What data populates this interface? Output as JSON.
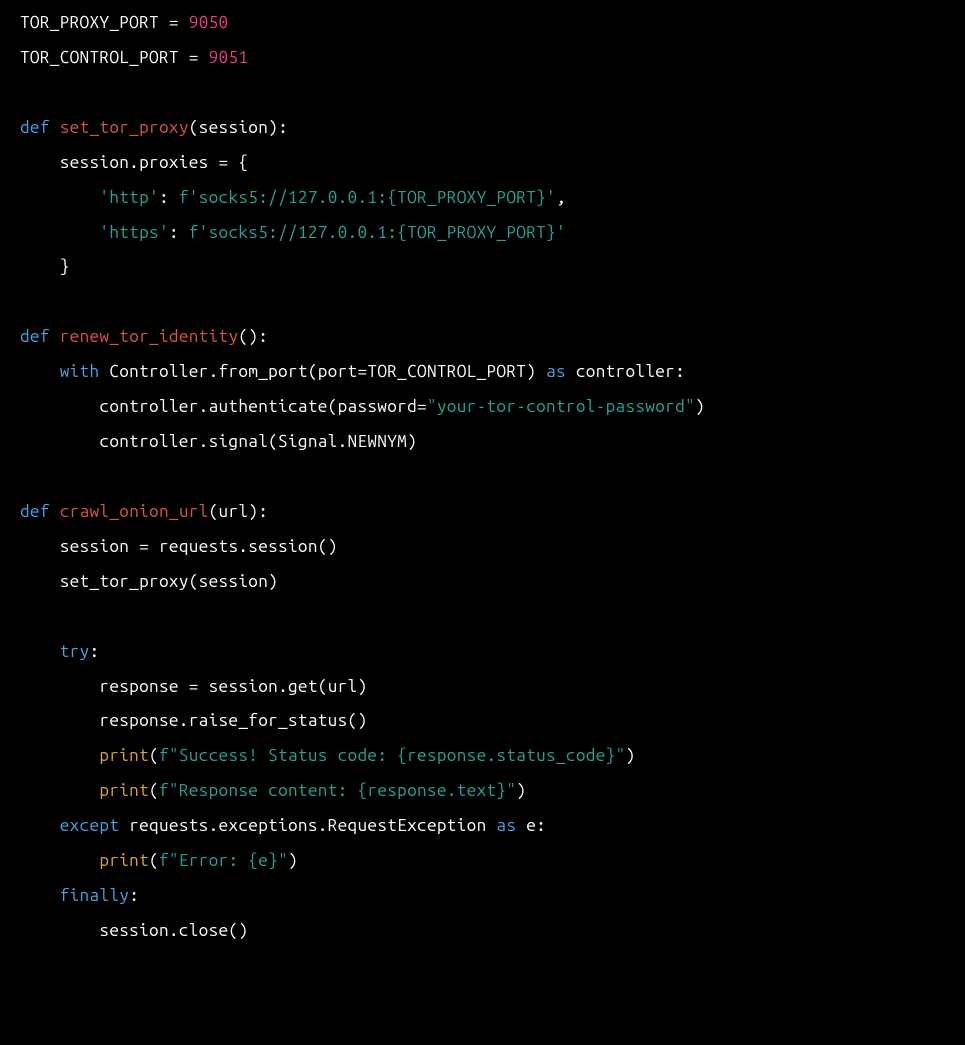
{
  "code_tokens": [
    [
      {
        "cls": "tok-const",
        "t": "TOR_PROXY_PORT"
      },
      {
        "cls": "tok-default",
        "t": " "
      },
      {
        "cls": "tok-op",
        "t": "="
      },
      {
        "cls": "tok-default",
        "t": " "
      },
      {
        "cls": "tok-number",
        "t": "9050"
      }
    ],
    [
      {
        "cls": "tok-const",
        "t": "TOR_CONTROL_PORT"
      },
      {
        "cls": "tok-default",
        "t": " "
      },
      {
        "cls": "tok-op",
        "t": "="
      },
      {
        "cls": "tok-default",
        "t": " "
      },
      {
        "cls": "tok-number",
        "t": "9051"
      }
    ],
    [],
    [
      {
        "cls": "tok-keyword",
        "t": "def"
      },
      {
        "cls": "tok-default",
        "t": " "
      },
      {
        "cls": "tok-funcdef",
        "t": "set_tor_proxy"
      },
      {
        "cls": "tok-paren",
        "t": "(session):"
      }
    ],
    [
      {
        "cls": "tok-default",
        "t": "    session.proxies "
      },
      {
        "cls": "tok-op",
        "t": "="
      },
      {
        "cls": "tok-default",
        "t": " {"
      }
    ],
    [
      {
        "cls": "tok-default",
        "t": "        "
      },
      {
        "cls": "tok-string",
        "t": "'http'"
      },
      {
        "cls": "tok-default",
        "t": ": "
      },
      {
        "cls": "tok-string",
        "t": "f'socks5://127.0.0.1:{TOR_PROXY_PORT}'"
      },
      {
        "cls": "tok-default",
        "t": ","
      }
    ],
    [
      {
        "cls": "tok-default",
        "t": "        "
      },
      {
        "cls": "tok-string",
        "t": "'https'"
      },
      {
        "cls": "tok-default",
        "t": ": "
      },
      {
        "cls": "tok-string",
        "t": "f'socks5://127.0.0.1:{TOR_PROXY_PORT}'"
      }
    ],
    [
      {
        "cls": "tok-default",
        "t": "    }"
      }
    ],
    [],
    [
      {
        "cls": "tok-keyword",
        "t": "def"
      },
      {
        "cls": "tok-default",
        "t": " "
      },
      {
        "cls": "tok-funcdef",
        "t": "renew_tor_identity"
      },
      {
        "cls": "tok-paren",
        "t": "():"
      }
    ],
    [
      {
        "cls": "tok-default",
        "t": "    "
      },
      {
        "cls": "tok-keyword",
        "t": "with"
      },
      {
        "cls": "tok-default",
        "t": " Controller.from_port(port"
      },
      {
        "cls": "tok-op",
        "t": "="
      },
      {
        "cls": "tok-default",
        "t": "TOR_CONTROL_PORT) "
      },
      {
        "cls": "tok-keyword",
        "t": "as"
      },
      {
        "cls": "tok-default",
        "t": " controller:"
      }
    ],
    [
      {
        "cls": "tok-default",
        "t": "        controller.authenticate(password"
      },
      {
        "cls": "tok-op",
        "t": "="
      },
      {
        "cls": "tok-string",
        "t": "\"your-tor-control-password\""
      },
      {
        "cls": "tok-default",
        "t": ")"
      }
    ],
    [
      {
        "cls": "tok-default",
        "t": "        controller.signal(Signal.NEWNYM)"
      }
    ],
    [],
    [
      {
        "cls": "tok-keyword",
        "t": "def"
      },
      {
        "cls": "tok-default",
        "t": " "
      },
      {
        "cls": "tok-funcdef",
        "t": "crawl_onion_url"
      },
      {
        "cls": "tok-paren",
        "t": "(url):"
      }
    ],
    [
      {
        "cls": "tok-default",
        "t": "    session "
      },
      {
        "cls": "tok-op",
        "t": "="
      },
      {
        "cls": "tok-default",
        "t": " requests.session()"
      }
    ],
    [
      {
        "cls": "tok-default",
        "t": "    set_tor_proxy(session)"
      }
    ],
    [],
    [
      {
        "cls": "tok-default",
        "t": "    "
      },
      {
        "cls": "tok-keyword",
        "t": "try"
      },
      {
        "cls": "tok-default",
        "t": ":"
      }
    ],
    [
      {
        "cls": "tok-default",
        "t": "        response "
      },
      {
        "cls": "tok-op",
        "t": "="
      },
      {
        "cls": "tok-default",
        "t": " session.get(url)"
      }
    ],
    [
      {
        "cls": "tok-default",
        "t": "        response.raise_for_status()"
      }
    ],
    [
      {
        "cls": "tok-default",
        "t": "        "
      },
      {
        "cls": "tok-builtin",
        "t": "print"
      },
      {
        "cls": "tok-default",
        "t": "("
      },
      {
        "cls": "tok-string",
        "t": "f\"Success! Status code: {response.status_code}\""
      },
      {
        "cls": "tok-default",
        "t": ")"
      }
    ],
    [
      {
        "cls": "tok-default",
        "t": "        "
      },
      {
        "cls": "tok-builtin",
        "t": "print"
      },
      {
        "cls": "tok-default",
        "t": "("
      },
      {
        "cls": "tok-string",
        "t": "f\"Response content: {response.text}\""
      },
      {
        "cls": "tok-default",
        "t": ")"
      }
    ],
    [
      {
        "cls": "tok-default",
        "t": "    "
      },
      {
        "cls": "tok-keyword",
        "t": "except"
      },
      {
        "cls": "tok-default",
        "t": " requests.exceptions.RequestException "
      },
      {
        "cls": "tok-keyword",
        "t": "as"
      },
      {
        "cls": "tok-default",
        "t": " e:"
      }
    ],
    [
      {
        "cls": "tok-default",
        "t": "        "
      },
      {
        "cls": "tok-builtin",
        "t": "print"
      },
      {
        "cls": "tok-default",
        "t": "("
      },
      {
        "cls": "tok-string",
        "t": "f\"Error: {e}\""
      },
      {
        "cls": "tok-default",
        "t": ")"
      }
    ],
    [
      {
        "cls": "tok-default",
        "t": "    "
      },
      {
        "cls": "tok-keyword",
        "t": "finally"
      },
      {
        "cls": "tok-default",
        "t": ":"
      }
    ],
    [
      {
        "cls": "tok-default",
        "t": "        session.close()"
      }
    ]
  ]
}
